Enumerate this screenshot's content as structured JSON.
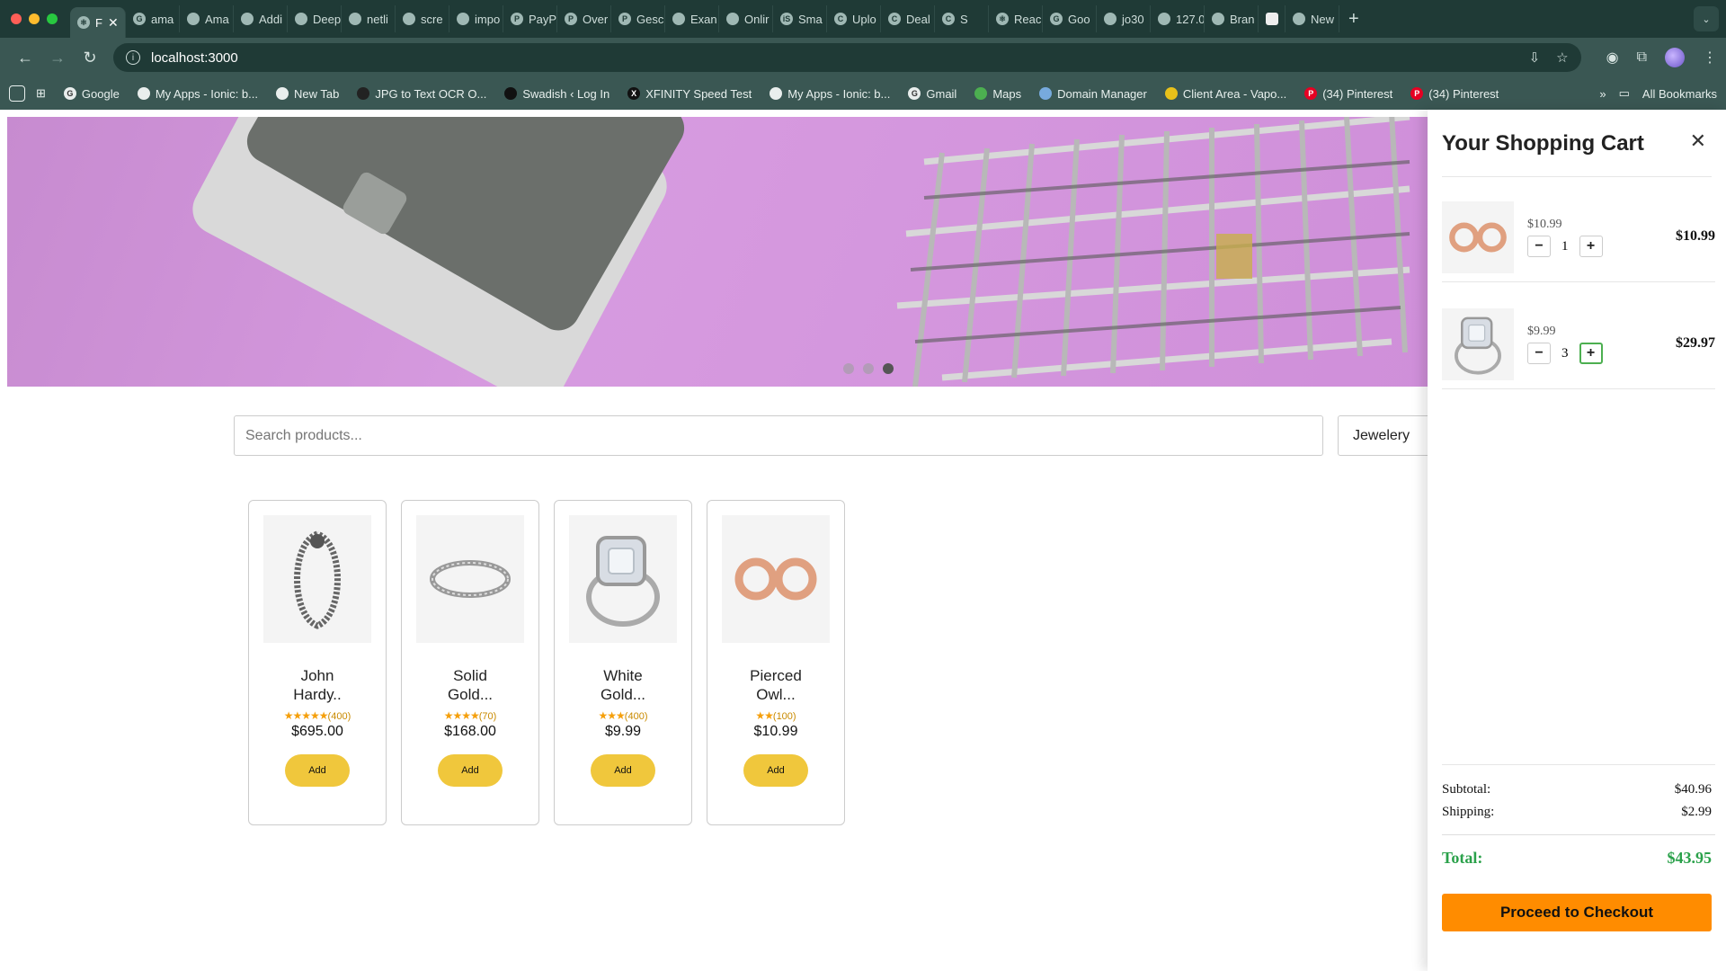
{
  "browser": {
    "tabs": [
      {
        "label": "F",
        "active": true
      },
      {
        "label": "ama"
      },
      {
        "label": "Ama"
      },
      {
        "label": "Addi"
      },
      {
        "label": "Deep"
      },
      {
        "label": "netli"
      },
      {
        "label": "scre"
      },
      {
        "label": "impo"
      },
      {
        "label": "PayP"
      },
      {
        "label": "Over"
      },
      {
        "label": "Gesc"
      },
      {
        "label": "Exan"
      },
      {
        "label": "Onlir"
      },
      {
        "label": "Sma"
      },
      {
        "label": "Uplo"
      },
      {
        "label": "Deal"
      },
      {
        "label": "S"
      },
      {
        "label": "Reac"
      },
      {
        "label": "Goo"
      },
      {
        "label": "jo30"
      },
      {
        "label": "127.0"
      },
      {
        "label": "Bran"
      },
      {
        "label": ""
      },
      {
        "label": "New"
      }
    ],
    "url": "localhost:3000",
    "bookmarks": [
      {
        "label": "Google"
      },
      {
        "label": "My Apps - Ionic: b..."
      },
      {
        "label": "New Tab"
      },
      {
        "label": "JPG to Text OCR O..."
      },
      {
        "label": "Swadish ‹ Log In"
      },
      {
        "label": "XFINITY Speed Test"
      },
      {
        "label": "My Apps - Ionic: b..."
      },
      {
        "label": "Gmail"
      },
      {
        "label": "Maps"
      },
      {
        "label": "Domain Manager"
      },
      {
        "label": "Client Area - Vapo..."
      },
      {
        "label": "(34) Pinterest"
      },
      {
        "label": "(34) Pinterest"
      }
    ],
    "all_bookmarks": "All Bookmarks"
  },
  "store": {
    "search_placeholder": "Search products...",
    "category_selected": "Jewelery",
    "carousel_slide_active": 3,
    "products": [
      {
        "name": "John Hardy..",
        "rating": "★★★★★",
        "count": "(400)",
        "price": "$695.00",
        "add": "Add",
        "icon": "bracelet-icon"
      },
      {
        "name": "Solid Gold...",
        "rating": "★★★★",
        "count": "(70)",
        "price": "$168.00",
        "add": "Add",
        "icon": "ring-icon"
      },
      {
        "name": "White Gold...",
        "rating": "★★★",
        "count": "(400)",
        "price": "$9.99",
        "add": "Add",
        "icon": "diamond-ring-icon"
      },
      {
        "name": "Pierced Owl...",
        "rating": "★★",
        "count": "(100)",
        "price": "$10.99",
        "add": "Add",
        "icon": "earrings-icon"
      }
    ]
  },
  "cart": {
    "title": "Your Shopping Cart",
    "items": [
      {
        "unit_price": "$10.99",
        "qty": "1",
        "total": "$10.99"
      },
      {
        "unit_price": "$9.99",
        "qty": "3",
        "total": "$29.97"
      }
    ],
    "subtotal_label": "Subtotal:",
    "subtotal": "$40.96",
    "shipping_label": "Shipping:",
    "shipping": "$2.99",
    "total_label": "Total:",
    "total": "$43.95",
    "checkout": "Proceed to Checkout"
  },
  "colors": {
    "accent_checkout": "#ff8c00",
    "add_button": "#f0c73c",
    "total_green": "#2aa14a",
    "chrome_bg": "#1f3a36"
  }
}
